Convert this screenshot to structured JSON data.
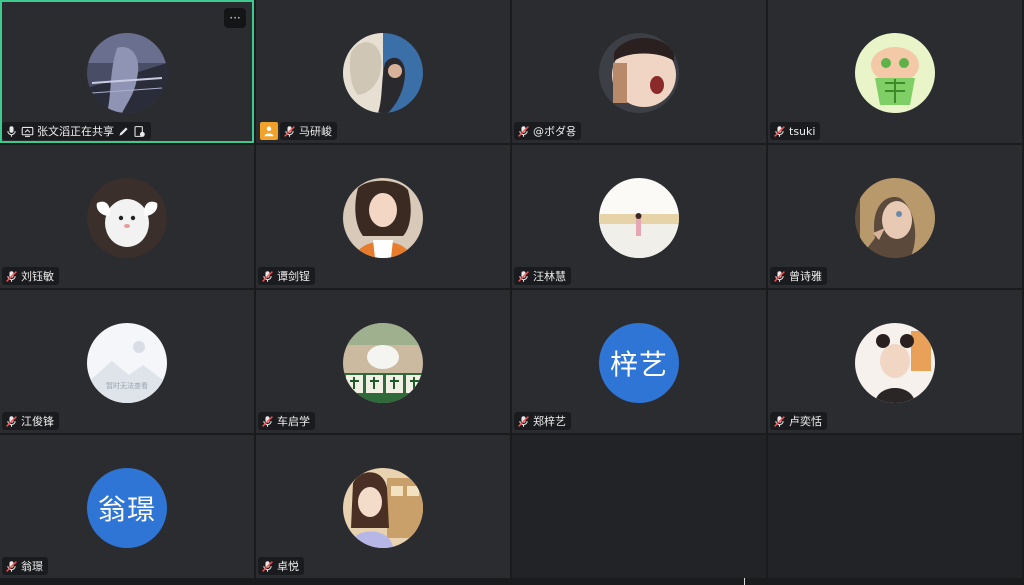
{
  "colors": {
    "tile_bg": "#2b2c2f",
    "active_border": "#3ec98e",
    "text_avatar_bg": "#2f75d6",
    "host_badge": "#f0a22a"
  },
  "more_button": {
    "label": "···",
    "icon": "more-options-icon"
  },
  "participants": [
    {
      "name": "张文滔正在共享",
      "status": "sharing",
      "icons": [
        "microphone-icon",
        "screen-share-icon",
        "annotate-icon",
        "record-icon"
      ],
      "avatar_kind": "photo",
      "active": true
    },
    {
      "name": "马研峻",
      "status": "muted",
      "icons": [
        "host-badge-icon",
        "muted-mic-icon"
      ],
      "avatar_kind": "photo"
    },
    {
      "name": "@ボダ용",
      "status": "muted",
      "icons": [
        "muted-mic-icon"
      ],
      "avatar_kind": "photo"
    },
    {
      "name": "tsuki",
      "status": "muted",
      "icons": [
        "muted-mic-icon"
      ],
      "avatar_kind": "photo"
    },
    {
      "name": "刘钰敏",
      "status": "muted",
      "icons": [
        "muted-mic-icon"
      ],
      "avatar_kind": "photo"
    },
    {
      "name": "谭剑锃",
      "status": "muted",
      "icons": [
        "muted-mic-icon"
      ],
      "avatar_kind": "photo"
    },
    {
      "name": "汪林慧",
      "status": "muted",
      "icons": [
        "muted-mic-icon"
      ],
      "avatar_kind": "photo"
    },
    {
      "name": "曾诗雅",
      "status": "muted",
      "icons": [
        "muted-mic-icon"
      ],
      "avatar_kind": "photo"
    },
    {
      "name": "江俊锋",
      "status": "muted",
      "icons": [
        "muted-mic-icon"
      ],
      "avatar_kind": "placeholder",
      "placeholder_text": "暂时无法查看"
    },
    {
      "name": "车启学",
      "status": "muted",
      "icons": [
        "muted-mic-icon"
      ],
      "avatar_kind": "photo"
    },
    {
      "name": "郑梓艺",
      "status": "muted",
      "icons": [
        "muted-mic-icon"
      ],
      "avatar_kind": "text",
      "avatar_text": "梓艺"
    },
    {
      "name": "卢奕恬",
      "status": "muted",
      "icons": [
        "muted-mic-icon"
      ],
      "avatar_kind": "photo"
    },
    {
      "name": "翁璟",
      "status": "muted",
      "icons": [
        "muted-mic-icon"
      ],
      "avatar_kind": "text",
      "avatar_text": "翁璟"
    },
    {
      "name": "卓悦",
      "status": "muted",
      "icons": [
        "muted-mic-icon"
      ],
      "avatar_kind": "photo"
    }
  ]
}
